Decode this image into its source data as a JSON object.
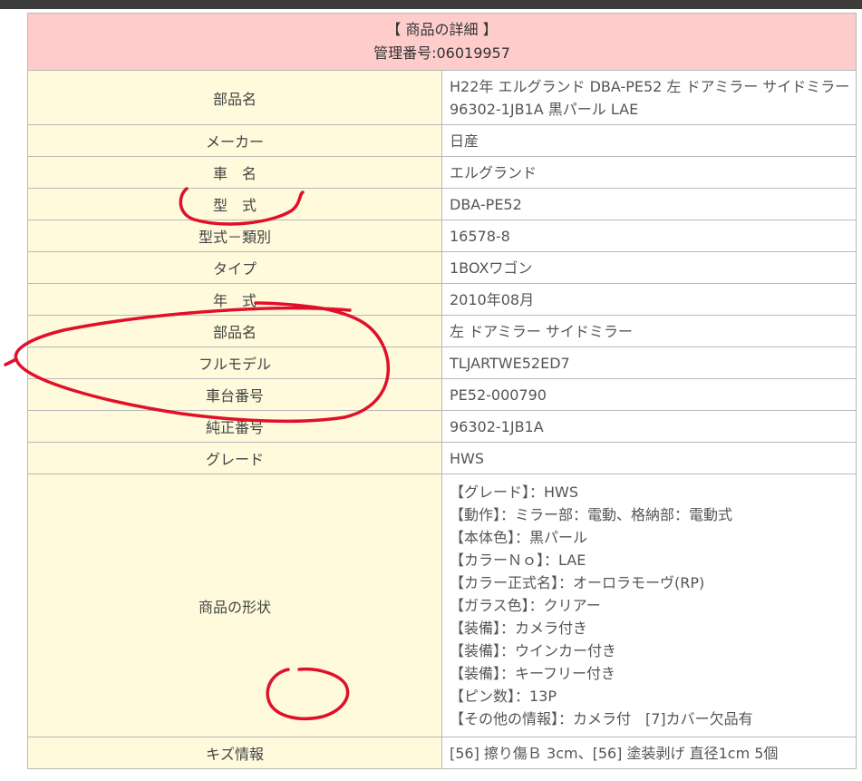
{
  "header": {
    "title": "【 商品の詳細 】",
    "management_no": "管理番号:06019957"
  },
  "rows": [
    {
      "label": "部品名",
      "value": "H22年 エルグランド DBA-PE52 左 ドアミラー サイドミラー 96302-1JB1A 黒パール LAE"
    },
    {
      "label": "メーカー",
      "value": "日産"
    },
    {
      "label": "車　名",
      "value": "エルグランド"
    },
    {
      "label": "型　式",
      "value": "DBA-PE52"
    },
    {
      "label": "型式－類別",
      "value": "16578-8"
    },
    {
      "label": "タイプ",
      "value": "1BOXワゴン"
    },
    {
      "label": "年　式",
      "value": "2010年08月"
    },
    {
      "label": "部品名",
      "value": "左 ドアミラー サイドミラー"
    },
    {
      "label": "フルモデル",
      "value": "TLJARTWE52ED7"
    },
    {
      "label": "車台番号",
      "value": "PE52-000790"
    },
    {
      "label": "純正番号",
      "value": "96302-1JB1A"
    },
    {
      "label": "グレード",
      "value": "HWS"
    }
  ],
  "shape": {
    "label": "商品の形状",
    "lines": [
      "【グレード】：HWS",
      "【動作】：ミラー部：電動、格納部：電動式",
      "【本体色】：黒パール",
      "【カラーＮｏ】：LAE",
      "【カラー正式名】：オーロラモーヴ(RP)",
      "【ガラス色】：クリアー",
      "【装備】：カメラ付き",
      "【装備】：ウインカー付き",
      "【装備】：キーフリー付き",
      "【ピン数】：13P",
      "【その他の情報】：カメラ付　[7]カバー欠品有"
    ]
  },
  "damage": {
    "label": "キズ情報",
    "value": "[56] 擦り傷Ｂ 3cm、[56] 塗装剥げ 直径1cm 5個"
  },
  "colors": {
    "header_bg": "#ffcccc",
    "label_bg": "#fefadb",
    "annotation_red": "#e0102a"
  }
}
